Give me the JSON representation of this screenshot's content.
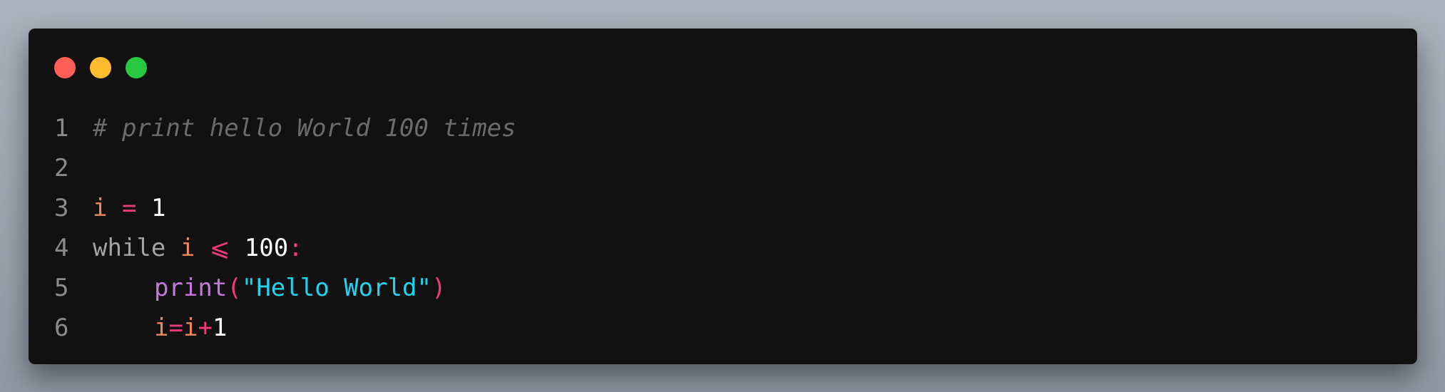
{
  "colors": {
    "background": "#111111",
    "traffic_red": "#ff5f57",
    "traffic_yellow": "#febc2e",
    "traffic_green": "#28c840",
    "comment": "#6b6b6b",
    "variable": "#f0895a",
    "operator": "#f0387b",
    "number": "#ffffff",
    "keyword": "#a3a3a3",
    "function": "#c678dd",
    "string": "#22d3ee",
    "punct": "#f0387b",
    "line_number": "#8a8a8a"
  },
  "window": {
    "buttons": [
      {
        "name": "close",
        "color": "#ff5f57"
      },
      {
        "name": "minimize",
        "color": "#febc2e"
      },
      {
        "name": "zoom",
        "color": "#28c840"
      }
    ]
  },
  "code": {
    "lines": [
      {
        "number": "1",
        "indent": 0,
        "tokens": [
          {
            "text": "# print hello World 100 times",
            "type": "comment"
          }
        ]
      },
      {
        "number": "2",
        "indent": 0,
        "tokens": []
      },
      {
        "number": "3",
        "indent": 0,
        "tokens": [
          {
            "text": "i",
            "type": "variable"
          },
          {
            "text": " ",
            "type": "space"
          },
          {
            "text": "=",
            "type": "operator"
          },
          {
            "text": " ",
            "type": "space"
          },
          {
            "text": "1",
            "type": "number"
          }
        ]
      },
      {
        "number": "4",
        "indent": 0,
        "tokens": [
          {
            "text": "while",
            "type": "keyword"
          },
          {
            "text": " ",
            "type": "space"
          },
          {
            "text": "i",
            "type": "variable"
          },
          {
            "text": " ",
            "type": "space"
          },
          {
            "text": "⩽",
            "type": "operator"
          },
          {
            "text": " ",
            "type": "space"
          },
          {
            "text": "100",
            "type": "number"
          },
          {
            "text": ":",
            "type": "punct"
          }
        ]
      },
      {
        "number": "5",
        "indent": 1,
        "tokens": [
          {
            "text": "print",
            "type": "function"
          },
          {
            "text": "(",
            "type": "punct"
          },
          {
            "text": "\"Hello World\"",
            "type": "string"
          },
          {
            "text": ")",
            "type": "punct"
          }
        ]
      },
      {
        "number": "6",
        "indent": 1,
        "tokens": [
          {
            "text": "i",
            "type": "variable"
          },
          {
            "text": "=",
            "type": "operator"
          },
          {
            "text": "i",
            "type": "variable"
          },
          {
            "text": "+",
            "type": "operator"
          },
          {
            "text": "1",
            "type": "number"
          }
        ]
      }
    ]
  }
}
